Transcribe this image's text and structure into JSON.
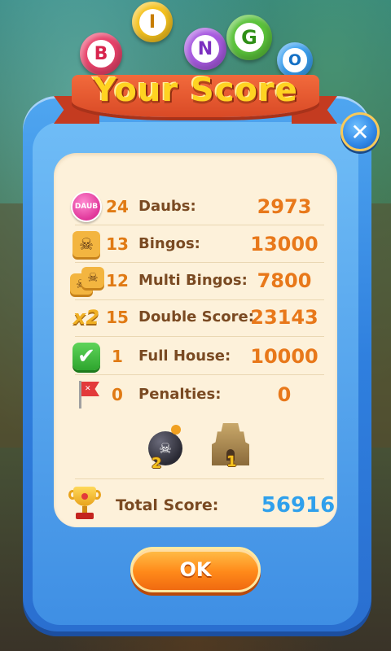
{
  "title": {
    "balls": [
      "B",
      "I",
      "N",
      "G",
      "O"
    ],
    "text": "Your Score"
  },
  "close": {
    "glyph": "✕"
  },
  "rows": [
    {
      "icon": "daub-icon",
      "icon_text": "DAUB",
      "count": "24",
      "label": "Daubs:",
      "value": "2973"
    },
    {
      "icon": "bingo-skull-tile-icon",
      "icon_text": "☠",
      "count": "13",
      "label": "Bingos:",
      "value": "13000"
    },
    {
      "icon": "multi-bingo-tiles-icon",
      "icon_text": "☠",
      "count": "12",
      "label": "Multi Bingos:",
      "value": "7800"
    },
    {
      "icon": "x2-icon",
      "icon_text": "x2",
      "count": "15",
      "label": "Double Score:",
      "value": "23143"
    },
    {
      "icon": "check-icon",
      "icon_text": "✔",
      "count": "1",
      "label": "Full House:",
      "value": "10000"
    },
    {
      "icon": "penalty-flag-icon",
      "icon_text": "✕",
      "count": "0",
      "label": "Penalties:",
      "value": "0"
    }
  ],
  "boosters": [
    {
      "icon": "bomb-icon",
      "icon_text": "☠",
      "count": "2"
    },
    {
      "icon": "temple-icon",
      "count": "1"
    }
  ],
  "total": {
    "label": "Total Score:",
    "value": "56916"
  },
  "ok_button": {
    "label": "OK"
  },
  "colors": {
    "panel_blue": "#2f7fde",
    "card_cream": "#fdf1da",
    "value_orange": "#e8781a",
    "total_blue": "#2fa0ec",
    "title_yellow": "#ffd321"
  }
}
